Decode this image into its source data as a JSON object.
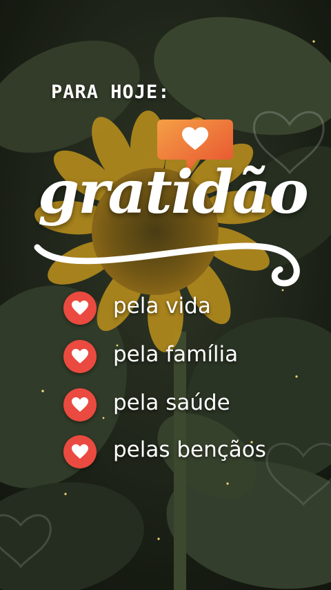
{
  "heading": "PARA HOJE:",
  "title": "gratidão",
  "items": [
    {
      "label": "pela vida"
    },
    {
      "label": "pela família"
    },
    {
      "label": "pela saúde"
    },
    {
      "label": "pelas bençãos"
    }
  ],
  "colors": {
    "accent_red": "#ea4a3f",
    "bubble_orange": "#f08a3c",
    "text": "#ffffff"
  },
  "icons": {
    "bubble": "heart-speech-bubble-icon",
    "bullet": "heart-check-icon"
  }
}
